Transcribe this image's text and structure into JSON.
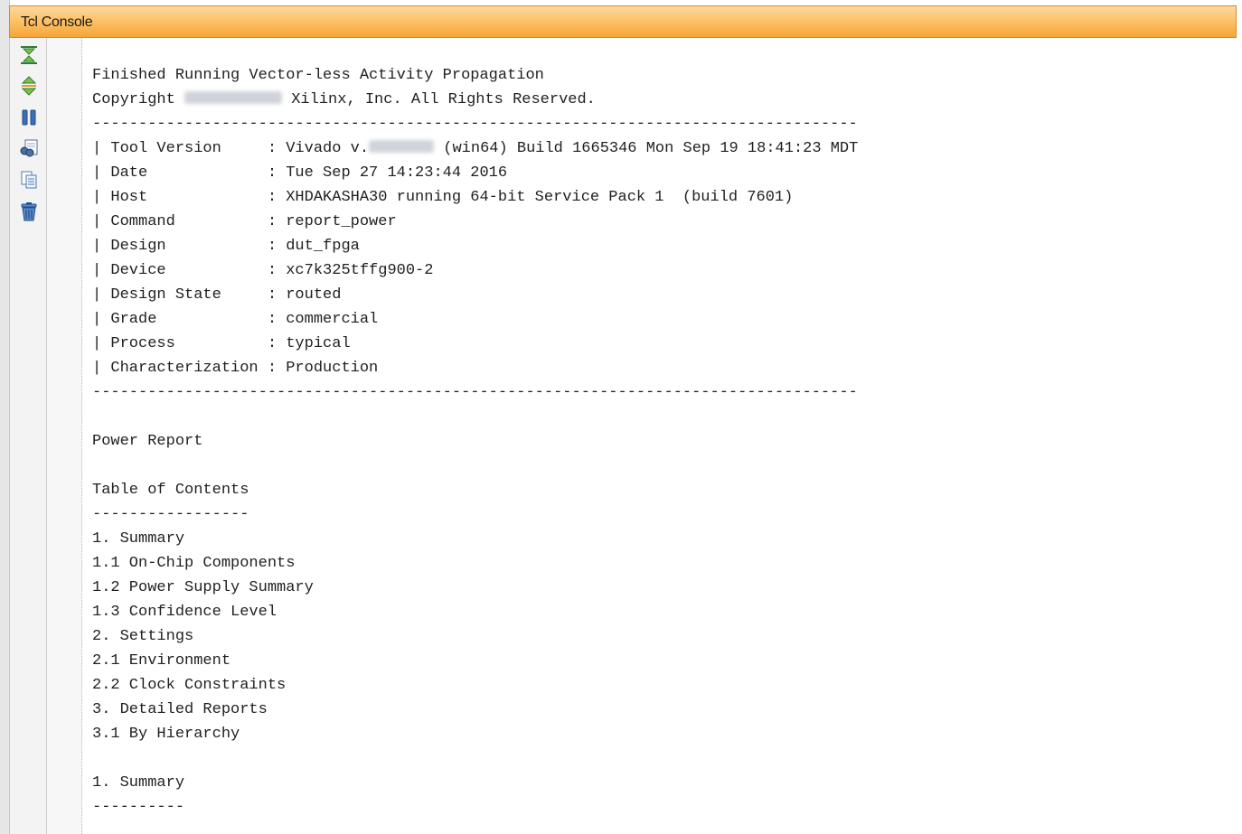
{
  "panel": {
    "title": "Tcl Console"
  },
  "toolbar": {
    "buttons": [
      {
        "name": "scroll-to-end-button",
        "icon": "collapse-arrows-icon"
      },
      {
        "name": "scroll-to-top-button",
        "icon": "expand-arrows-icon"
      },
      {
        "name": "pause-button",
        "icon": "pause-icon"
      },
      {
        "name": "find-button",
        "icon": "binoculars-icon"
      },
      {
        "name": "copy-button",
        "icon": "copy-icon"
      },
      {
        "name": "clear-button",
        "icon": "trash-icon"
      }
    ]
  },
  "console": {
    "l01": "Finished Running Vector-less Activity Propagation",
    "l02a": "Copyright ",
    "l02b": " Xilinx, Inc. All Rights Reserved.",
    "l03": "-----------------------------------------------------------------------------------",
    "l04a": "| Tool Version     : Vivado v.",
    "l04b": " (win64) Build 1665346 Mon Sep 19 18:41:23 MDT",
    "l05": "| Date             : Tue Sep 27 14:23:44 2016",
    "l06": "| Host             : XHDAKASHA30 running 64-bit Service Pack 1  (build 7601)",
    "l07": "| Command          : report_power",
    "l08": "| Design           : dut_fpga",
    "l09": "| Device           : xc7k325tffg900-2",
    "l10": "| Design State     : routed",
    "l11": "| Grade            : commercial",
    "l12": "| Process          : typical",
    "l13": "| Characterization : Production",
    "l14": "-----------------------------------------------------------------------------------",
    "l15": "Power Report",
    "l16": "Table of Contents",
    "l17": "-----------------",
    "l18": "1. Summary",
    "l19": "1.1 On-Chip Components",
    "l20": "1.2 Power Supply Summary",
    "l21": "1.3 Confidence Level",
    "l22": "2. Settings",
    "l23": "2.1 Environment",
    "l24": "2.2 Clock Constraints",
    "l25": "3. Detailed Reports",
    "l26": "3.1 By Hierarchy",
    "l27": "1. Summary",
    "l28": "----------"
  }
}
